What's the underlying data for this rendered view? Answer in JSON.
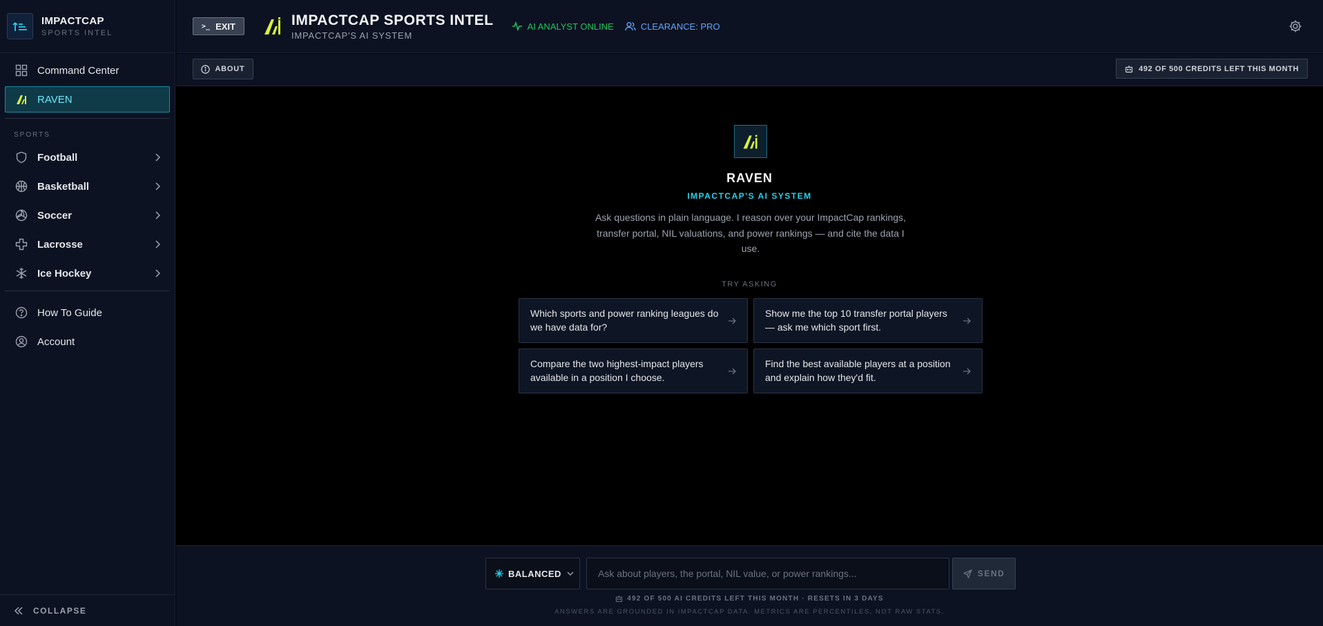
{
  "brand": {
    "title": "IMPACTCAP",
    "subtitle": "SPORTS INTEL"
  },
  "sidebar": {
    "items": [
      {
        "label": "Command Center",
        "icon": "grid-icon"
      },
      {
        "label": "RAVEN",
        "icon": "raven-icon",
        "active": true
      }
    ],
    "section_label": "SPORTS",
    "sports": [
      {
        "label": "Football",
        "icon": "shield-icon"
      },
      {
        "label": "Basketball",
        "icon": "basketball-icon"
      },
      {
        "label": "Soccer",
        "icon": "volleyball-icon"
      },
      {
        "label": "Lacrosse",
        "icon": "cross-icon"
      },
      {
        "label": "Ice Hockey",
        "icon": "snowflake-icon"
      }
    ],
    "bottom_items": [
      {
        "label": "How To Guide",
        "icon": "help-circle-icon"
      },
      {
        "label": "Account",
        "icon": "user-circle-icon"
      }
    ],
    "collapse_label": "COLLAPSE"
  },
  "header": {
    "exit_label": "EXIT",
    "title": "IMPACTCAP SPORTS INTEL",
    "subtitle": "IMPACTCAP'S AI SYSTEM",
    "status_online": "AI ANALYST ONLINE",
    "clearance": "CLEARANCE: PRO"
  },
  "subbar": {
    "about_label": "ABOUT",
    "credits": "492 OF 500 CREDITS LEFT THIS MONTH"
  },
  "main": {
    "title": "RAVEN",
    "subtitle": "IMPACTCAP'S AI SYSTEM",
    "description": "Ask questions in plain language. I reason over your ImpactCap rankings, transfer portal, NIL valuations, and power rankings — and cite the data I use.",
    "try_label": "TRY ASKING",
    "suggestions": [
      "Which sports and power ranking leagues do we have data for?",
      "Show me the top 10 transfer portal players — ask me which sport first.",
      "Compare the two highest-impact players available in a position I choose.",
      "Find the best available players at a position and explain how they'd fit."
    ]
  },
  "footer": {
    "mode_label": "BALANCED",
    "input_placeholder": "Ask about players, the portal, NIL value, or power rankings...",
    "input_value": "",
    "send_label": "SEND",
    "credits_line": "492 OF 500 AI CREDITS LEFT THIS MONTH · RESETS IN 3 DAYS",
    "note": "ANSWERS ARE GROUNDED IN IMPACTCAP DATA. METRICS ARE PERCENTILES, NOT RAW STATS."
  },
  "colors": {
    "accent_cyan": "#22d3ee",
    "accent_lime": "#d9f23a",
    "online_green": "#22c55e",
    "clearance_blue": "#60a5fa",
    "sidebar_bg": "#0c1221"
  }
}
